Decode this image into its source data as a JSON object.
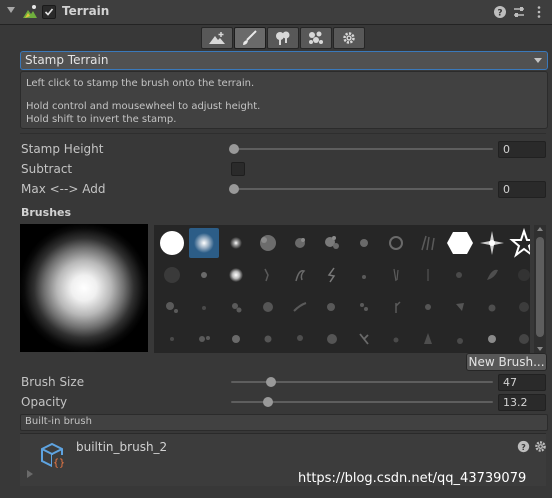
{
  "header": {
    "title": "Terrain",
    "enabled": true,
    "icons": [
      "help-icon",
      "preset-icon",
      "more-icon"
    ]
  },
  "toolbar": {
    "tools": [
      {
        "name": "raise-terrain-tool-icon",
        "active": false
      },
      {
        "name": "paint-brush-tool-icon",
        "active": true
      },
      {
        "name": "paint-trees-tool-icon",
        "active": false
      },
      {
        "name": "paint-details-tool-icon",
        "active": false
      },
      {
        "name": "settings-tool-icon",
        "active": false
      }
    ]
  },
  "mode_dropdown": {
    "value": "Stamp Terrain"
  },
  "help": {
    "line1": "Left click to stamp the brush onto the terrain.",
    "line2": "Hold control and mousewheel to adjust height.",
    "line3": "Hold shift to invert the stamp."
  },
  "fields": {
    "stamp_height": {
      "label": "Stamp Height",
      "value": "0"
    },
    "subtract": {
      "label": "Subtract",
      "checked": false
    },
    "max_add": {
      "label": "Max <--> Add",
      "value": "0"
    },
    "brush_size": {
      "label": "Brush Size",
      "value": "47"
    },
    "opacity": {
      "label": "Opacity",
      "value": "13.2"
    }
  },
  "brushes": {
    "title": "Brushes",
    "selected_index": 1,
    "new_brush_label": "New Brush..."
  },
  "builtin_label": "Built-in brush",
  "asset": {
    "name": "builtin_brush_2"
  },
  "watermark": "https://blog.csdn.net/qq_43739079",
  "colors": {
    "accent": "#3a79bb",
    "selected": "#2c5d87",
    "background": "#383838"
  }
}
